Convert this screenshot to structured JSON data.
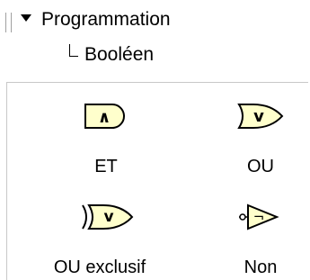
{
  "tree": {
    "category": "Programmation",
    "subcategory": "Booléen"
  },
  "palette": {
    "items": [
      {
        "label": "ET",
        "icon": "and-gate-icon",
        "symbol": "∧"
      },
      {
        "label": "OU",
        "icon": "or-gate-icon",
        "symbol": "v"
      },
      {
        "label": "OU exclusif",
        "icon": "xor-gate-icon",
        "symbol": "v"
      },
      {
        "label": "Non",
        "icon": "not-gate-icon",
        "symbol": "¬"
      }
    ]
  },
  "colors": {
    "gate_fill": "#ffffcc",
    "gate_stroke": "#000000",
    "divider": "#c8c8c8"
  }
}
